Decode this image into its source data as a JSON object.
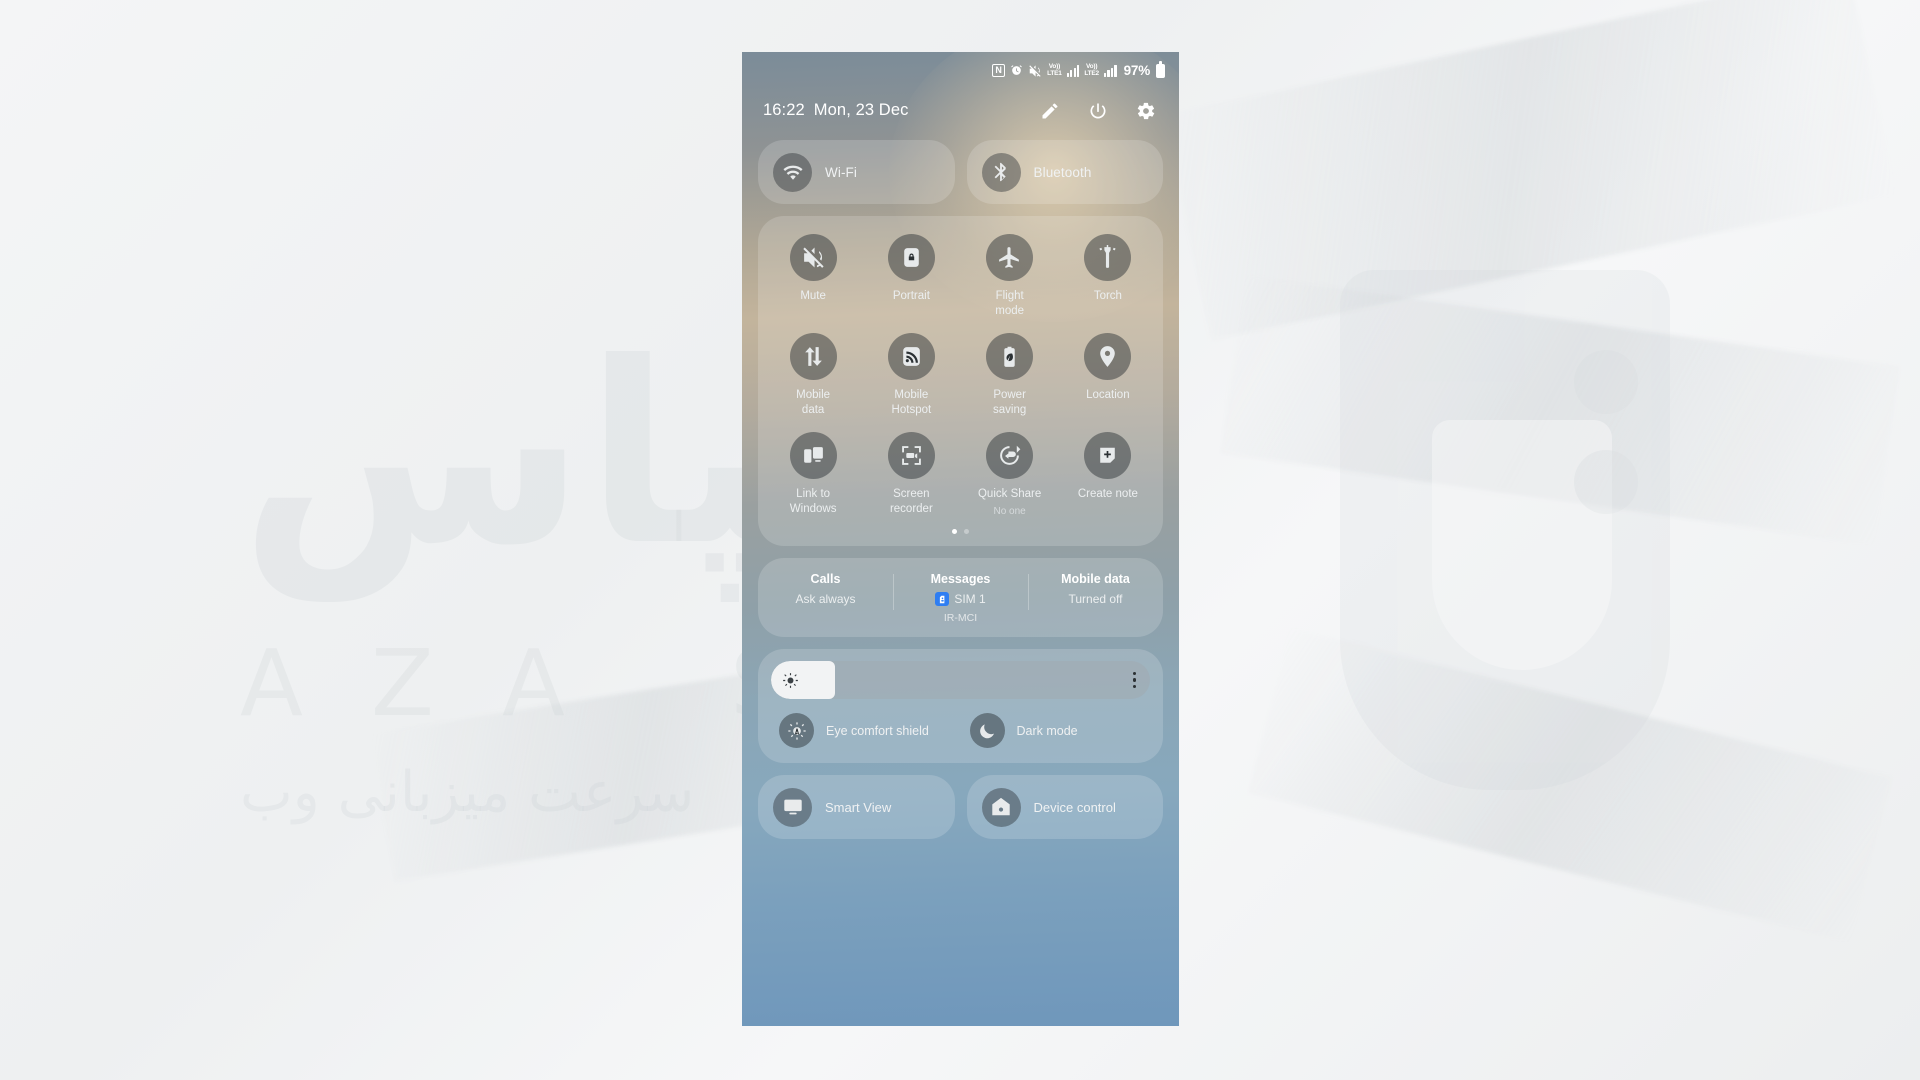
{
  "backdrop": {
    "watermark_word": "اسپاس",
    "watermark_latin": "AZA S",
    "watermark_persian": "سرعت میزبانی وب"
  },
  "statusbar": {
    "icons": [
      "nfc-icon",
      "alarm-icon",
      "mute-icon"
    ],
    "nfc_glyph": "N",
    "sim1": {
      "volte_top": "Vo))",
      "volte_bottom": "LTE1",
      "signal_bars": 4
    },
    "sim2": {
      "volte_top": "Vo))",
      "volte_bottom": "LTE2",
      "signal_bars": 4
    },
    "battery_percent": "97%"
  },
  "header": {
    "time": "16:22",
    "date": "Mon, 23 Dec",
    "actions": [
      {
        "name": "edit-button",
        "label": "Edit"
      },
      {
        "name": "power-button",
        "label": "Power off"
      },
      {
        "name": "settings-button",
        "label": "Settings"
      }
    ]
  },
  "connectivity": [
    {
      "name": "wifi-toggle",
      "label": "Wi-Fi",
      "icon": "wifi-icon",
      "active": false
    },
    {
      "name": "bluetooth-toggle",
      "label": "Bluetooth",
      "icon": "bluetooth-icon",
      "active": false
    }
  ],
  "quick_toggles": [
    {
      "label": "Mute",
      "icon": "mute-icon",
      "sub": ""
    },
    {
      "label": "Portrait",
      "icon": "rotation-lock-icon",
      "sub": ""
    },
    {
      "label": "Flight\nmode",
      "icon": "airplane-icon",
      "sub": ""
    },
    {
      "label": "Torch",
      "icon": "flashlight-icon",
      "sub": ""
    },
    {
      "label": "Mobile\ndata",
      "icon": "mobile-data-icon",
      "sub": ""
    },
    {
      "label": "Mobile\nHotspot",
      "icon": "hotspot-icon",
      "sub": ""
    },
    {
      "label": "Power\nsaving",
      "icon": "power-saving-icon",
      "sub": ""
    },
    {
      "label": "Location",
      "icon": "location-pin-icon",
      "sub": ""
    },
    {
      "label": "Link to\nWindows",
      "icon": "link-to-windows-icon",
      "sub": ""
    },
    {
      "label": "Screen\nrecorder",
      "icon": "screen-recorder-icon",
      "sub": ""
    },
    {
      "label": "Quick Share",
      "icon": "quick-share-icon",
      "sub": "No one"
    },
    {
      "label": "Create note",
      "icon": "create-note-icon",
      "sub": ""
    }
  ],
  "page_dots": {
    "count": 2,
    "active_index": 0
  },
  "sim_panel": [
    {
      "title": "Calls",
      "value": "Ask always",
      "badge": false,
      "carrier": ""
    },
    {
      "title": "Messages",
      "value": "SIM 1",
      "badge": true,
      "carrier": "IR-MCI"
    },
    {
      "title": "Mobile data",
      "value": "Turned off",
      "badge": false,
      "carrier": ""
    }
  ],
  "brightness": {
    "level_percent": 17,
    "icon": "brightness-sun-icon",
    "more_label": "More brightness options"
  },
  "display_toggles": [
    {
      "label": "Eye comfort shield",
      "icon": "eye-comfort-icon"
    },
    {
      "label": "Dark mode",
      "icon": "moon-icon"
    }
  ],
  "bottom_toggles": [
    {
      "label": "Smart View",
      "icon": "smart-view-icon"
    },
    {
      "label": "Device control",
      "icon": "device-control-icon"
    }
  ],
  "colors": {
    "accent_blue": "#2f7ef2",
    "tile_bg": "rgba(38,44,48,.46)",
    "card_bg": "rgba(255,255,255,.17)",
    "slider_fill": "#f2f3f4"
  }
}
